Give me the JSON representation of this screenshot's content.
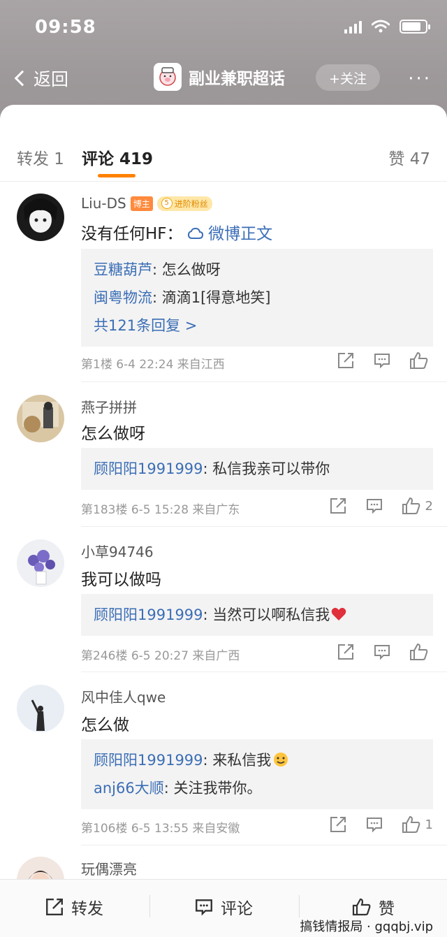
{
  "status": {
    "time": "09:58"
  },
  "nav": {
    "back_label": "返回",
    "title": "副业兼职超话",
    "follow_label": "+关注",
    "more_label": "···"
  },
  "tabs": {
    "repost": "转发 1",
    "comments": "评论 419",
    "likes": "赞 47"
  },
  "comments": [
    {
      "user": "Liu-DS",
      "badge_blogger": "博主",
      "badge_fan_level": "5",
      "badge_fan": "进阶粉丝",
      "text": "没有任何HF：",
      "link": "微博正文",
      "replies": [
        {
          "who": "豆糖葫芦",
          "text": ": 怎么做呀"
        },
        {
          "who": "闽粤物流",
          "text": ": 滴滴1[得意地笑]"
        }
      ],
      "more_replies": "共121条回复 >",
      "meta": "第1楼 6-4 22:24 来自江西",
      "likes": ""
    },
    {
      "user": "燕子拼拼",
      "text": "怎么做呀",
      "replies": [
        {
          "who": "顾阳阳1991999",
          "text": ": 私信我亲可以带你"
        }
      ],
      "meta": "第183楼 6-5 15:28 来自广东",
      "likes": "2"
    },
    {
      "user": "小草94746",
      "text": "我可以做吗",
      "replies": [
        {
          "who": "顾阳阳1991999",
          "text": ": 当然可以啊私信我"
        }
      ],
      "meta": "第246楼 6-5 20:27 来自广西",
      "likes": ""
    },
    {
      "user": "风中佳人qwe",
      "text": "怎么做",
      "replies": [
        {
          "who": "顾阳阳1991999",
          "text": ": 来私信我"
        },
        {
          "who": "anj66大顺",
          "text": ": 关注我带你。"
        }
      ],
      "meta": "第106楼 6-5 13:55 来自安徽",
      "likes": "1"
    },
    {
      "user": "玩偶漂亮"
    }
  ],
  "bottom": {
    "repost": "转发",
    "comment": "评论",
    "like": "赞"
  },
  "watermark": "搞钱情报局 · gqqbj.vip",
  "colors": {
    "accent": "#ff8200",
    "link": "#3b6eb6"
  }
}
